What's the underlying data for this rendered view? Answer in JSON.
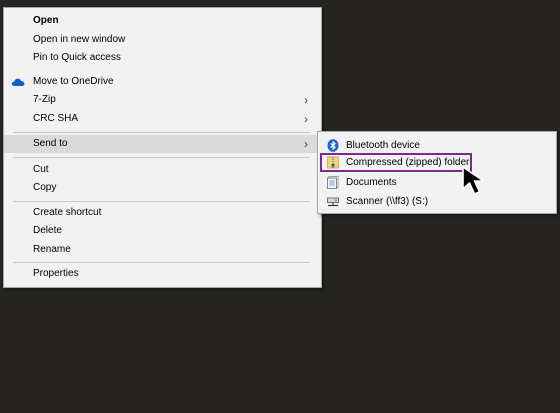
{
  "context_menu": {
    "items": {
      "open": "Open",
      "open_new_window": "Open in new window",
      "pin_quick_access": "Pin to Quick access",
      "move_onedrive": "Move to OneDrive",
      "seven_zip": "7-Zip",
      "crc_sha": "CRC SHA",
      "send_to": "Send to",
      "cut": "Cut",
      "copy": "Copy",
      "create_shortcut": "Create shortcut",
      "delete": "Delete",
      "rename": "Rename",
      "properties": "Properties"
    }
  },
  "send_to_submenu": {
    "items": {
      "bluetooth": "Bluetooth device",
      "compressed": "Compressed (zipped) folder",
      "documents": "Documents",
      "scanner": "Scanner (\\\\ff3) (S:)"
    }
  },
  "icons": {
    "onedrive": "cloud-icon",
    "bluetooth": "bluetooth-icon",
    "compressed": "zip-folder-icon",
    "documents": "documents-icon",
    "scanner": "network-drive-icon",
    "submenu_arrow": "chevron-right-icon",
    "cursor": "mouse-cursor-icon"
  },
  "colors": {
    "background": "#262522",
    "menu_bg": "#f2f2f2",
    "hover_bg": "#dadada",
    "highlight_border": "#7a2a8c",
    "onedrive_blue": "#0a64c8",
    "bluetooth_blue": "#1464d2"
  }
}
